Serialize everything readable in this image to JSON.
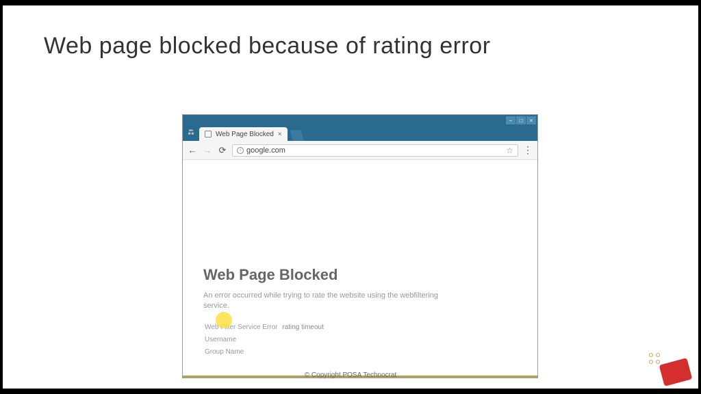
{
  "slide": {
    "title": "Web page blocked because of rating error"
  },
  "browser": {
    "tab_title": "Web Page Blocked",
    "url": "google.com",
    "window_controls": {
      "minimize": "−",
      "maximize": "□",
      "close": "×"
    },
    "nav": {
      "back": "←",
      "forward": "→",
      "reload": "⟳"
    }
  },
  "page": {
    "heading": "Web Page Blocked",
    "message": "An error occurred while trying to rate the website using the webfiltering service.",
    "details": [
      {
        "label": "Web Filter Service Error",
        "value": "rating timeout"
      },
      {
        "label": "Username",
        "value": ""
      },
      {
        "label": "Group Name",
        "value": ""
      }
    ]
  },
  "footer": {
    "copyright": "© Copyright POSA Technocrat"
  }
}
